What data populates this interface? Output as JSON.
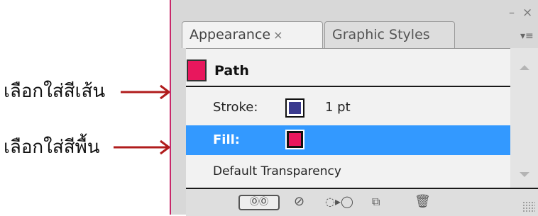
{
  "annotations": {
    "stroke_note": "เลือกใส่สีเส้น",
    "fill_note": "เลือกใส่สีพื้น"
  },
  "window": {
    "minimize_glyph": "–",
    "close_glyph": "×"
  },
  "tabs": [
    {
      "label": "Appearance",
      "close_glyph": "×",
      "active": true
    },
    {
      "label": "Graphic Styles",
      "active": false
    }
  ],
  "panel_menu_glyph": "▾≡",
  "appearance": {
    "object_label": "Path",
    "object_color": "#e8175d",
    "stroke_label": "Stroke:",
    "stroke_color": "#3b3b8f",
    "stroke_weight": "1 pt",
    "fill_label": "Fill:",
    "fill_color": "#e8175d",
    "transparency_label": "Default Transparency"
  },
  "colors": {
    "selection": "#3399ff",
    "arrow": "#b01c1c"
  },
  "toolbar": {
    "toggle_icon": "toggle-basic-appearance",
    "toggle_glyph": "ⓄⓄ",
    "clear_glyph": "⊘",
    "duplicate_glyph": "◌▸◯",
    "new_glyph": "⧉",
    "delete_glyph": "🗑"
  }
}
